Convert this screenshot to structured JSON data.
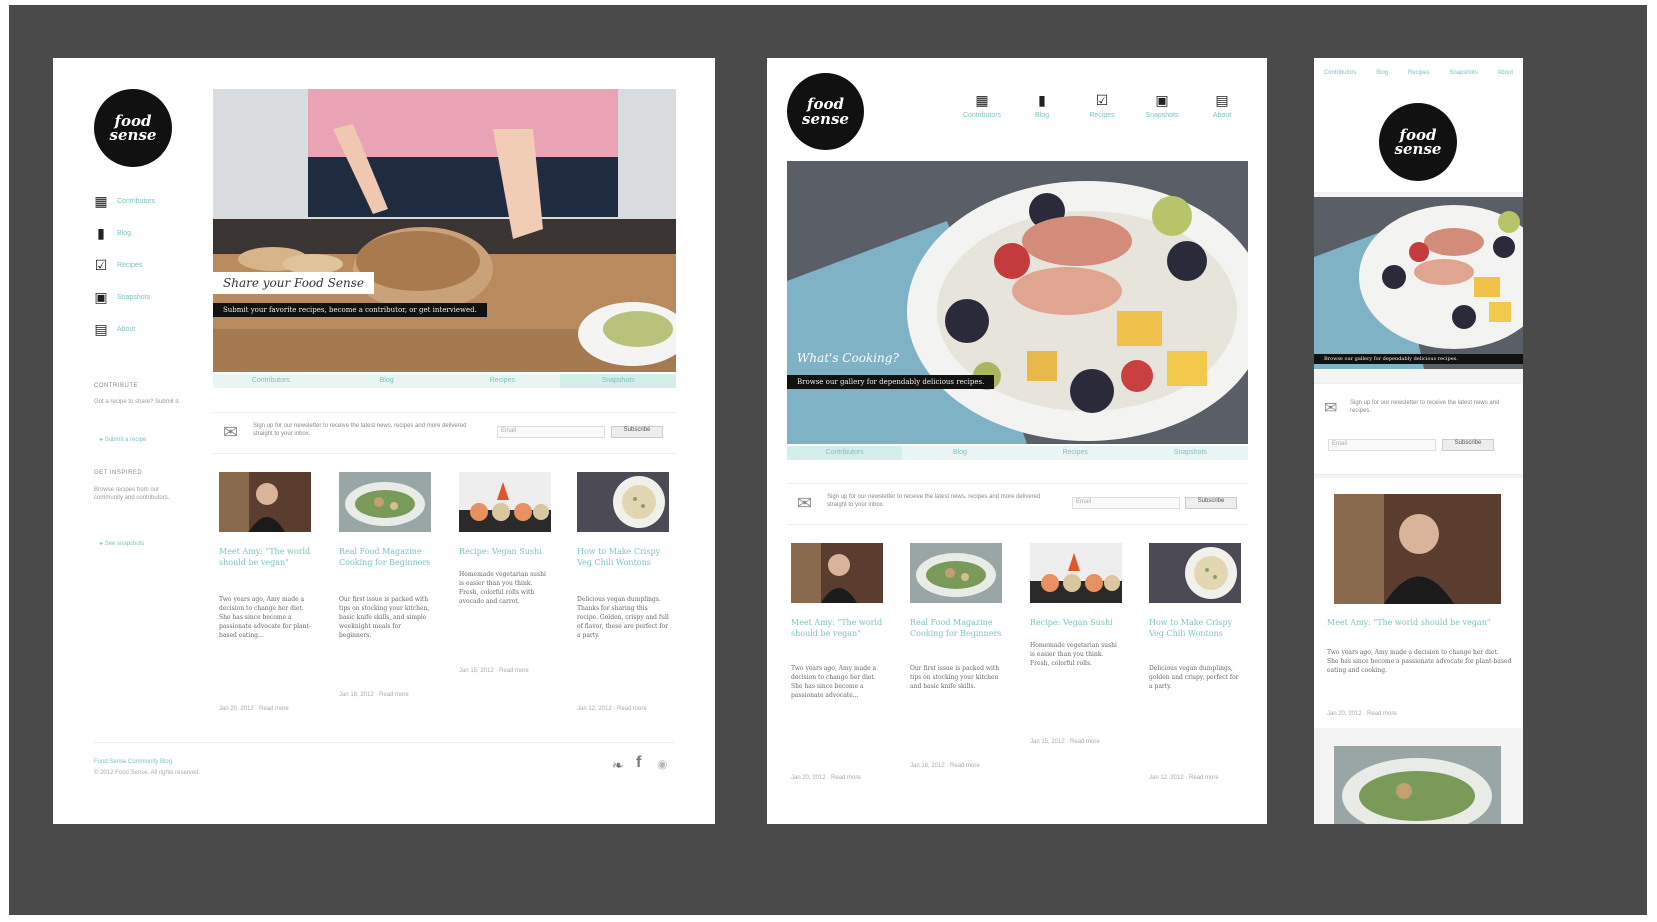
{
  "brand": {
    "logo_text": "food sense"
  },
  "desktop": {
    "nav": [
      {
        "label": "Contributors",
        "icon": "contributors-icon"
      },
      {
        "label": "Blog",
        "icon": "book-icon"
      },
      {
        "label": "Recipes",
        "icon": "checklist-icon"
      },
      {
        "label": "Snapshots",
        "icon": "camera-icon"
      },
      {
        "label": "About",
        "icon": "notebook-icon"
      }
    ],
    "sidebar": {
      "h1": "CONTRIBUTE",
      "p1": "Got a recipe to share? Submit it.",
      "link1": "Submit a recipe",
      "h2": "GET INSPIRED",
      "p2": "Browse recipes from our community and contributors.",
      "link2": "See snapshots"
    },
    "hero": {
      "title": "Share your Food Sense",
      "sub": "Submit your favorite recipes, become a contributor, or get interviewed."
    },
    "tabs": [
      "Contributors",
      "Blog",
      "Recipes",
      "Snapshots"
    ],
    "newsletter": {
      "text": "Sign up for our newsletter to receive the latest news, recipes and more delivered straight to your inbox.",
      "placeholder": "Email",
      "button": "Subscribe"
    },
    "posts": [
      {
        "title": "Meet Amy: \"The world should be vegan\"",
        "body": "Two years ago, Amy made a decision to change her diet. She has since become a passionate advocate for plant-based eating...",
        "meta": "Jan 20, 2012 · Read more"
      },
      {
        "title": "Real Food Magazine Cooking for Beginners",
        "body": "Our first issue is packed with tips on stocking your kitchen, basic knife skills, and simple weeknight meals for beginners.",
        "meta": "Jan 18, 2012 · Read more"
      },
      {
        "title": "Recipe: Vegan Sushi",
        "body": "Homemade vegetarian sushi is easier than you think. Fresh, colorful rolls with avocado and carrot.",
        "meta": "Jan 15, 2012 · Read more"
      },
      {
        "title": "How to Make Crispy Veg Chili Wontons",
        "body": "Delicious vegan dumplings. Thanks for sharing this recipe. Golden, crispy and full of flavor, these are perfect for a party.",
        "meta": "Jan 12, 2012 · Read more"
      }
    ],
    "footer": {
      "line1": "Food Sense Community Blog",
      "line2": "© 2012 Food Sense. All rights reserved."
    }
  },
  "tablet": {
    "nav": [
      {
        "label": "Contributors",
        "icon": "contributors-icon"
      },
      {
        "label": "Blog",
        "icon": "book-icon"
      },
      {
        "label": "Recipes",
        "icon": "checklist-icon"
      },
      {
        "label": "Snapshots",
        "icon": "camera-icon"
      },
      {
        "label": "About",
        "icon": "notebook-icon"
      }
    ],
    "hero": {
      "title": "What's Cooking?",
      "sub": "Browse our gallery for dependably delicious recipes."
    },
    "tabs": [
      "Contributors",
      "Blog",
      "Recipes",
      "Snapshots"
    ],
    "newsletter": {
      "text": "Sign up for our newsletter to receive the latest news, recipes and more delivered straight to your inbox.",
      "placeholder": "Email",
      "button": "Subscribe"
    },
    "posts": [
      {
        "title": "Meet Amy: \"The world should be vegan\"",
        "body": "Two years ago, Amy made a decision to change her diet. She has since become a passionate advocate...",
        "meta": "Jan 20, 2012 · Read more"
      },
      {
        "title": "Real Food Magazine Cooking for Beginners",
        "body": "Our first issue is packed with tips on stocking your kitchen and basic knife skills.",
        "meta": "Jan 18, 2012 · Read more"
      },
      {
        "title": "Recipe: Vegan Sushi",
        "body": "Homemade vegetarian sushi is easier than you think. Fresh, colorful rolls.",
        "meta": "Jan 15, 2012 · Read more"
      },
      {
        "title": "How to Make Crispy Veg Chili Wontons",
        "body": "Delicious vegan dumplings, golden and crispy, perfect for a party.",
        "meta": "Jan 12, 2012 · Read more"
      }
    ]
  },
  "mobile": {
    "nav": [
      "Contributors",
      "Blog",
      "Recipes",
      "Snapshots",
      "About"
    ],
    "hero": {
      "sub": "Browse our gallery for dependably delicious recipes."
    },
    "newsletter": {
      "text": "Sign up for our newsletter to receive the latest news and recipes.",
      "placeholder": "Email",
      "button": "Subscribe"
    },
    "post": {
      "title": "Meet Amy: \"The world should be vegan\"",
      "body": "Two years ago, Amy made a decision to change her diet. She has since become a passionate advocate for plant-based eating and cooking.",
      "meta": "Jan 20, 2012 · Read more"
    }
  },
  "colors": {
    "frame": "#4a4a4a",
    "accent": "#7fc2bf",
    "black": "#111111"
  }
}
